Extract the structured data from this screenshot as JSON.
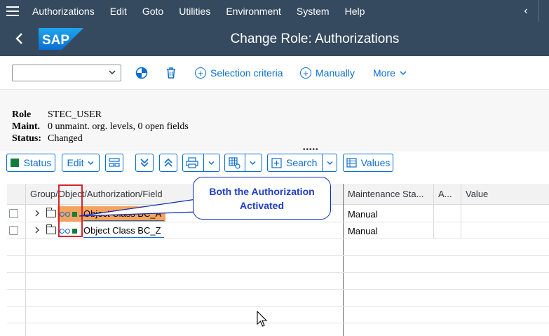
{
  "menubar": {
    "items": [
      "Authorizations",
      "Edit",
      "Goto",
      "Utilities",
      "Environment",
      "System",
      "Help"
    ],
    "chevron": "‹"
  },
  "titlebar": {
    "back_icon": "back-arrow-icon",
    "logo_text": "SAP",
    "title": "Change Role: Authorizations",
    "colors": {
      "bar": "#354a5f",
      "logo": "#0a6ed1"
    }
  },
  "toolbar": {
    "dropdown_value": "",
    "selection_criteria": "Selection criteria",
    "manually": "Manually",
    "more": "More"
  },
  "role_header": {
    "role_label": "Role",
    "role_value": "STEC_USER",
    "maint_label": "Maint.",
    "maint_value": "0 unmaint. org. levels, 0 open fields",
    "status_label": "Status:",
    "status_value": "Changed"
  },
  "table_toolbar": {
    "status": "Status",
    "edit": "Edit",
    "search": "Search",
    "values": "Values"
  },
  "table": {
    "columns": [
      "Group/Object/Authorization/Field",
      "Maintenance Sta...",
      "A...",
      "Value"
    ],
    "rows": [
      {
        "label": "Object Class BC_A",
        "maintenance": "Manual",
        "status_color": "#107e3e"
      },
      {
        "label": "Object Class BC_Z",
        "maintenance": "Manual",
        "status_color": "#107e3e"
      }
    ]
  },
  "annotation": {
    "callout_text": "Both the Authorization Activated",
    "highlight_color": "#f4a460",
    "box_color": "#d3262e"
  }
}
